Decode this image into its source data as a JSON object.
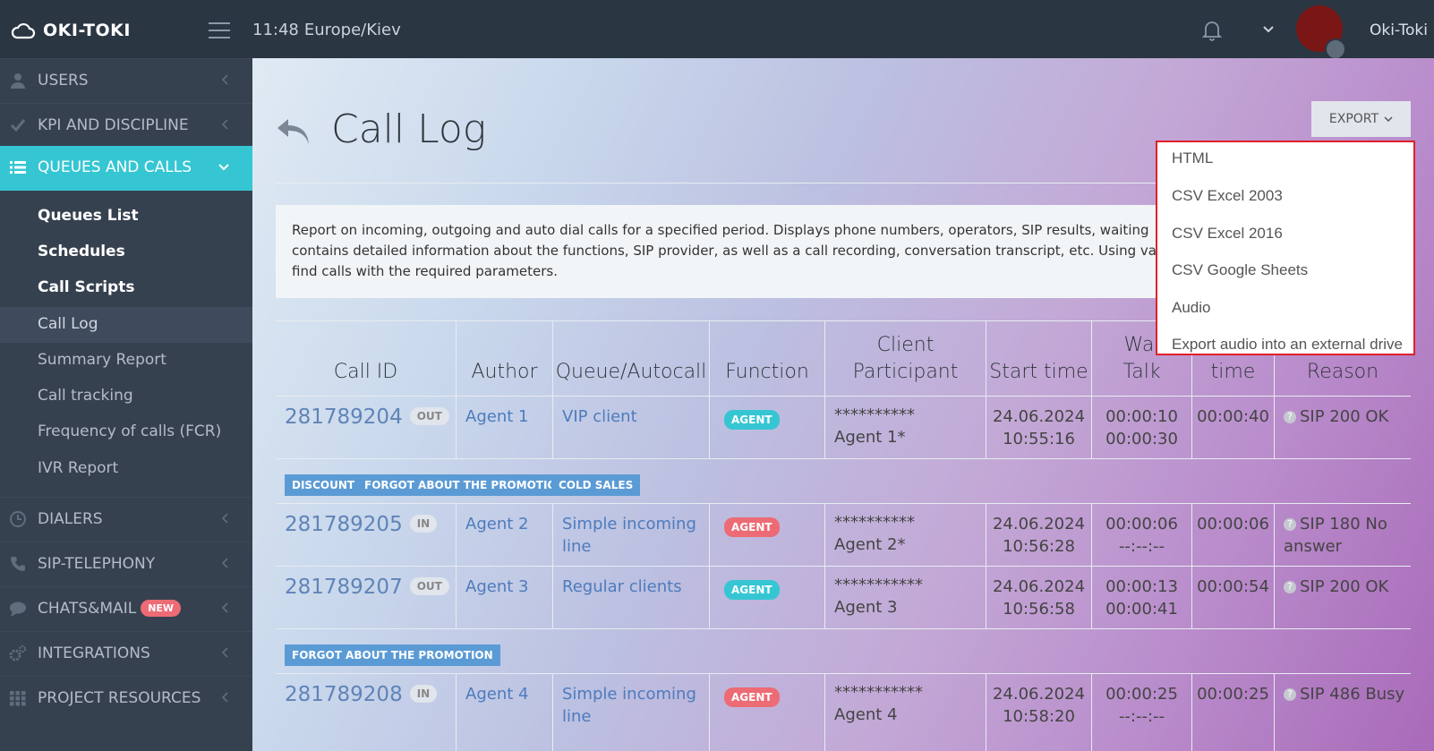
{
  "brand": "OKI-TOKI",
  "header": {
    "time": "11:48",
    "timezone": "Europe/Kiev",
    "user": "Oki-Toki"
  },
  "sidebar": {
    "users": "USERS",
    "kpi": "KPI AND DISCIPLINE",
    "queues": "QUEUES AND CALLS",
    "sub": [
      "Queues List",
      "Schedules",
      "Call Scripts",
      "Call Log",
      "Summary Report",
      "Call tracking",
      "Frequency of calls (FCR)",
      "IVR Report"
    ],
    "dialers": "DIALERS",
    "sip": "SIP-TELEPHONY",
    "chats": "CHATS&MAIL",
    "new_badge": "NEW",
    "integrations": "INTEGRATIONS",
    "resources": "PROJECT RESOURCES"
  },
  "page": {
    "title": "Call Log",
    "export_label": "EXPORT",
    "note": "Report on incoming, outgoing and auto dial calls for a specified period. Displays phone numbers, operators, SIP results, waiting\ncontains detailed information about the functions, SIP provider, as well as a call recording, conversation transcript, etc. Using va\nfind calls with the required parameters."
  },
  "export_menu": [
    "HTML",
    "CSV Excel 2003",
    "CSV Excel 2016",
    "CSV Google Sheets",
    "Audio",
    "Export audio into an external drive"
  ],
  "table": {
    "headers": {
      "call_id": "Call ID",
      "author": "Author",
      "queue": "Queue/Autocall",
      "function": "Function",
      "client_l1": "Client",
      "client_l2": "Participant",
      "start": "Start time",
      "wait_l1": "Wai",
      "wait_l2": "Talk",
      "time": "time",
      "reason": "Reason"
    },
    "rows": [
      {
        "id": "281789204",
        "dir": "OUT",
        "author": "Agent 1",
        "queue": "VIP client",
        "queue2": "",
        "function": "AGENT",
        "client": "**********",
        "participant": "Agent 1*",
        "date": "24.06.2024",
        "start": "10:55:16",
        "wait": "00:00:10",
        "talk": "00:00:30",
        "time": "00:00:40",
        "reason": "SIP 200 OK",
        "reason2": ""
      },
      {
        "id": "281789205",
        "dir": "IN",
        "author": "Agent 2",
        "queue": "Simple incoming",
        "queue2": "line",
        "function": "AGENT",
        "client": "**********",
        "participant": "Agent 2*",
        "date": "24.06.2024",
        "start": "10:56:28",
        "wait": "00:00:06",
        "talk": "--:--:--",
        "time": "00:00:06",
        "reason": "SIP 180 No",
        "reason2": "answer"
      },
      {
        "id": "281789207",
        "dir": "OUT",
        "author": "Agent 3",
        "queue": "Regular clients",
        "queue2": "",
        "function": "AGENT",
        "client": "***********",
        "participant": "Agent 3",
        "date": "24.06.2024",
        "start": "10:56:58",
        "wait": "00:00:13",
        "talk": "00:00:41",
        "time": "00:00:54",
        "reason": "SIP 200 OK",
        "reason2": ""
      },
      {
        "id": "281789208",
        "dir": "IN",
        "author": "Agent 4",
        "queue": "Simple incoming",
        "queue2": "line",
        "function": "AGENT",
        "client": "***********",
        "participant": "Agent 4",
        "date": "24.06.2024",
        "start": "10:58:20",
        "wait": "00:00:25",
        "talk": "--:--:--",
        "time": "00:00:25",
        "reason": "SIP 486 Busy",
        "reason2": ""
      }
    ],
    "tags1": [
      "DISCOUNT",
      "FORGOT ABOUT THE PROMOTION",
      "COLD SALES"
    ],
    "tags2": [
      "FORGOT ABOUT THE PROMOTION"
    ]
  },
  "colors": {
    "accent": "#36c6d3",
    "agent_red": "#ed6b75",
    "tag_blue": "#5b9bd5",
    "sidebar": "#364150",
    "topbar": "#2b3643",
    "highlight": "#e0202a"
  }
}
